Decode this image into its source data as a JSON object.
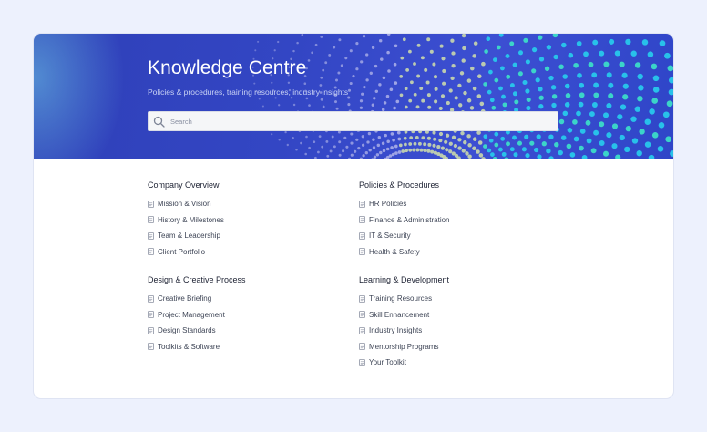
{
  "hero": {
    "title": "Knowledge Centre",
    "subtitle": "Policies & procedures, training resources, industry insights"
  },
  "search": {
    "placeholder": "Search",
    "value": ""
  },
  "icons": {
    "search": "search-icon",
    "item": "document-icon"
  },
  "colors": {
    "hero_blue": "#3346c4",
    "accent_cyan": "#2fd4e0",
    "page_background": "#edf1fd"
  },
  "sections": [
    {
      "title": "Company Overview",
      "items": [
        "Mission & Vision",
        "History & Milestones",
        "Team & Leadership",
        "Client Portfolio"
      ]
    },
    {
      "title": "Policies & Procedures",
      "items": [
        "HR Policies",
        "Finance & Administration",
        "IT & Security",
        "Health & Safety"
      ]
    },
    {
      "title": "Design & Creative Process",
      "items": [
        "Creative Briefing",
        "Project Management",
        "Design Standards",
        "Toolkits & Software"
      ]
    },
    {
      "title": "Learning & Development",
      "items": [
        "Training Resources",
        "Skill Enhancement",
        "Industry Insights",
        "Mentorship Programs",
        "Your Toolkit"
      ]
    }
  ]
}
